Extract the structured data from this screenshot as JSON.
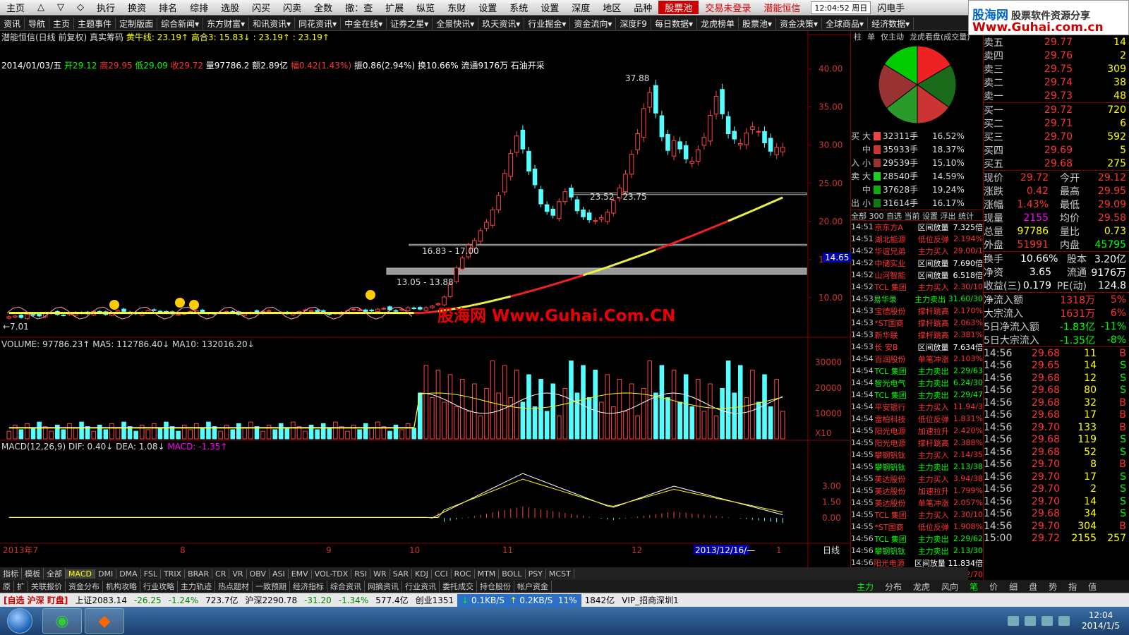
{
  "menu": {
    "items": [
      "主页",
      "△",
      "▽",
      "◇",
      "执行",
      "换资",
      "排名",
      "综排",
      "选股",
      "闪买",
      "闪卖",
      "全数",
      "撤：查",
      "扩展",
      "纵览",
      "东财",
      "设置",
      "系统",
      "设置",
      "深度",
      "地区",
      "品种"
    ],
    "highlight": "股票池",
    "login": "交易未登录",
    "stockname": "潜能恒信",
    "clock": "12:04:52 周日",
    "flash": "闪电手"
  },
  "brand": {
    "line1a": "股海网",
    "line1b": "股票软件资源分享",
    "line2": "Www.Guhai.com.cn"
  },
  "toolbar2": [
    "资讯",
    "导航",
    "主页",
    "主题事件",
    "定制版面",
    "综合新闻▾",
    "东方财富▾",
    "和讯资讯▾",
    "同花资讯▾",
    "中金在线▾",
    "证券之星▾",
    "全景快讯▾",
    "玖天资讯▾",
    "行业掘金▾",
    "资金流向▾",
    "深度F9",
    "每日数据▾",
    "龙虎榜单",
    "股票池▾",
    "资金决策▾",
    "全球商品▾",
    "经济数据▾"
  ],
  "chart": {
    "header1": "潜能恒信(日线 前复权) 真实筹码",
    "header1b": "黄牛线: 23.19↑ 高合3: 15.83↓ : 23.19↑ : 23.19↑",
    "date": "2014/01/03/五",
    "open": "开29.12",
    "high": "高29.95",
    "low": "低29.09",
    "close": "收29.72",
    "vol": "量97786.2",
    "amount": "额2.89亿",
    "chg": "幅0.42(1.43%)",
    "rest": "振0.86(2.94%) 换10.66% 流通9176万 石油开采",
    "peak_label": "37.88",
    "low_label": "←7.01",
    "zone1": "23.52 - 23.75",
    "zone2": "16.83 - 17.00",
    "zone3": "13.05 - 13.88",
    "price_marker": "14.65",
    "price_axis": [
      "40.00",
      "35.00",
      "30.00",
      "25.00",
      "20.00",
      "15.00",
      "10.00"
    ],
    "vol_header": "VOLUME: 97786.23↑  MA5: 112786.40↓  MA10: 132016.20↓",
    "vol_axis": [
      "30000",
      "20000",
      "10000",
      "X10"
    ],
    "macd_header": "MACD(12,26,9)  DIF: 0.40↓  DEA: 1.08↓",
    "macd_val": "MACD: -1.35↑",
    "macd_axis": [
      "3.00",
      "1.50",
      "0.00"
    ],
    "date_axis": [
      "2013年7",
      "8",
      "9",
      "10",
      "11",
      "12",
      "2013/12/16/—",
      "1"
    ],
    "period": "日线"
  },
  "chart_data": {
    "type": "candlestick",
    "title": "潜能恒信(日线 前复权)",
    "price_range": [
      5,
      42
    ],
    "candles": [
      [
        29.12,
        29.95,
        29.09,
        29.72
      ]
    ],
    "price_series_close_approx": [
      7.5,
      7.6,
      7.4,
      7.8,
      7.7,
      7.6,
      7.9,
      8.0,
      7.8,
      7.7,
      7.9,
      8.1,
      8.0,
      7.9,
      8.2,
      8.0,
      7.8,
      8.1,
      8.3,
      8.2,
      8.0,
      7.9,
      8.1,
      8.3,
      8.4,
      8.2,
      8.0,
      7.9,
      7.8,
      8.0,
      8.2,
      8.3,
      8.1,
      8.0,
      7.9,
      8.1,
      8.2,
      8.0,
      7.8,
      7.9,
      8.1,
      8.0,
      8.2,
      8.3,
      8.1,
      8.0,
      7.9,
      8.0,
      8.2,
      8.4,
      8.3,
      8.1,
      8.0,
      7.8,
      8.0,
      8.1,
      8.3,
      8.5,
      8.4,
      8.2,
      8.3,
      8.5,
      8.6,
      8.4,
      8.3,
      8.5,
      8.7,
      8.6,
      8.5,
      8.7,
      8.9,
      9.2,
      10.1,
      11.8,
      13.9,
      15.2,
      16.9,
      17.5,
      18.8,
      19.9,
      21.5,
      23.4,
      26.3,
      28.9,
      31.2,
      29.5,
      26.6,
      24.8,
      22.3,
      21.3,
      20.8,
      22.6,
      23.9,
      23.2,
      21.4,
      20.6,
      20.2,
      20.1,
      20.5,
      21.2,
      22.7,
      24.4,
      26.2,
      28.8,
      31.5,
      34.8,
      36.9,
      34.2,
      31.1,
      29.3,
      30.6,
      29.5,
      28.2,
      27.9,
      29.4,
      31.0,
      33.9,
      36.4,
      34.1,
      31.5,
      30.8,
      30.2,
      31.6,
      32.4,
      31.8,
      30.3,
      29.2,
      29.7,
      29.72
    ],
    "volume_range": [
      0,
      36000
    ],
    "volume_ma5_last": 112786.4,
    "volume_ma10_last": 132016.2,
    "volume_last": 97786.23,
    "macd": {
      "dif": 0.4,
      "dea": 1.08,
      "macd": -1.35
    },
    "zones": [
      "23.52 - 23.75",
      "16.83 - 17.00",
      "13.05 - 13.88"
    ]
  },
  "fund": {
    "tabs": [
      "柱",
      "单",
      "仅主动",
      "龙虎看盘(成交量)"
    ],
    "pie_colors": [
      "#e22",
      "#1a6b1a",
      "#c33",
      "#2a9a2a",
      "#933",
      "#0c0"
    ],
    "buy_label": [
      "买",
      "入"
    ],
    "sell_label": [
      "卖",
      "出"
    ],
    "rows": [
      {
        "k": "大",
        "v": "32311手",
        "p": "16.52%",
        "c": "#e44"
      },
      {
        "k": "中",
        "v": "35933手",
        "p": "18.37%",
        "c": "#c33"
      },
      {
        "k": "小",
        "v": "29539手",
        "p": "15.10%",
        "c": "#933"
      },
      {
        "k": "大",
        "v": "28540手",
        "p": "14.59%",
        "c": "#2c2"
      },
      {
        "k": "中",
        "v": "37628手",
        "p": "19.24%",
        "c": "#1a1"
      },
      {
        "k": "小",
        "v": "31614手",
        "p": "16.17%",
        "c": "#171"
      }
    ],
    "filter": "全部 300 自选 当前 设置 浮出 统计"
  },
  "flow": [
    [
      "14:51",
      "京东方A",
      "区间放量",
      "7.325倍",
      "wht"
    ],
    [
      "14:51",
      "湖北能源",
      "低位反弹",
      "2.194%",
      "red"
    ],
    [
      "14:52",
      "华谊兄弟",
      "主力买入",
      "29.00/1",
      "red"
    ],
    [
      "14:52",
      "中储实业",
      "区间放量",
      "7.690倍",
      "wht"
    ],
    [
      "14:52",
      "山河智能",
      "区间放量",
      "6.518倍",
      "wht"
    ],
    [
      "14:52",
      "TCL 集团",
      "主力买入",
      "2.30/10",
      "red"
    ],
    [
      "14:53",
      "易华录",
      "主力卖出",
      "31.60/30",
      "grn"
    ],
    [
      "14:53",
      "宝德股份",
      "撑杆跳高",
      "2.170%",
      "red"
    ],
    [
      "14:53",
      "*ST国商",
      "撑杆跳高",
      "2.063%",
      "red"
    ],
    [
      "14:53",
      "新华联",
      "撑杆跳高",
      "2.381%",
      "red"
    ],
    [
      "14:53",
      "长 安B",
      "区间放量",
      "7.634倍",
      "wht"
    ],
    [
      "14:54",
      "百润股份",
      "单笔冲涨",
      "2.103%",
      "red"
    ],
    [
      "14:54",
      "TCL 集团",
      "主力卖出",
      "2.29/63",
      "grn"
    ],
    [
      "14:54",
      "智光电气",
      "主力卖出",
      "6.24/30",
      "grn"
    ],
    [
      "14:54",
      "TCL 集团",
      "主力卖出",
      "2.29/47",
      "grn"
    ],
    [
      "14:54",
      "平安银行",
      "主力买入",
      "11.94/3",
      "red"
    ],
    [
      "14:54",
      "雷柏科技",
      "低位反弹",
      "1.831%",
      "red"
    ],
    [
      "14:55",
      "阳光电源",
      "加速拉升",
      "2.420%",
      "red"
    ],
    [
      "14:55",
      "阳光电源",
      "撑杆跳高",
      "2.388%",
      "red"
    ],
    [
      "14:55",
      "攀钢钒钛",
      "主力买入",
      "2.14/35",
      "red"
    ],
    [
      "14:55",
      "攀钢钒钛",
      "主力卖出",
      "2.13/38",
      "grn"
    ],
    [
      "14:55",
      "美达股份",
      "主力买入",
      "3.94/38",
      "red"
    ],
    [
      "14:55",
      "美达股份",
      "加速拉升",
      "1.799%",
      "red"
    ],
    [
      "14:55",
      "美达股份",
      "单笔冲涨",
      "2.057%",
      "red"
    ],
    [
      "14:55",
      "TCL 集团",
      "主力买入",
      "2.30/10",
      "red"
    ],
    [
      "14:55",
      "*ST国商",
      "低位反弹",
      "1.908%",
      "red"
    ],
    [
      "14:56",
      "TCL 集团",
      "主力卖出",
      "2.29/62",
      "grn"
    ],
    [
      "14:56",
      "攀钢钒钛",
      "主力卖出",
      "2.13/30",
      "grn"
    ],
    [
      "14:56",
      "阳光电源",
      "区间放量",
      "11.834倍",
      "wht"
    ],
    [
      "14:56",
      "三湘股份",
      "主力买入",
      "6.52/70",
      "red"
    ],
    [
      "14:56",
      "中钢吉炭",
      "加速拉升",
      "1.816%",
      "red"
    ],
    [
      "14:56",
      "凯迪电力",
      "主力卖出",
      "6.38/41",
      "grn"
    ],
    [
      "14:56",
      "山东路桥",
      "低位反弹",
      "1.869%",
      "red"
    ],
    [
      "14:56",
      "山东路桥",
      "撑杆跳高",
      "2.570%",
      "red"
    ]
  ],
  "quote": {
    "code": "300191 潜能恒信",
    "asks": [
      [
        "卖五",
        "29.77",
        "14"
      ],
      [
        "卖四",
        "29.76",
        "2"
      ],
      [
        "卖三",
        "29.75",
        "309"
      ],
      [
        "卖二",
        "29.74",
        "38"
      ],
      [
        "卖一",
        "29.73",
        "48"
      ]
    ],
    "bids": [
      [
        "买一",
        "29.72",
        "720"
      ],
      [
        "买二",
        "29.71",
        "6"
      ],
      [
        "买三",
        "29.70",
        "592"
      ],
      [
        "买四",
        "29.69",
        "5"
      ],
      [
        "买五",
        "29.68",
        "275"
      ]
    ],
    "stats": [
      [
        "现价",
        "29.72",
        "red",
        "今开",
        "29.12",
        "red"
      ],
      [
        "涨跌",
        "0.42",
        "red",
        "最高",
        "29.95",
        "red"
      ],
      [
        "涨幅",
        "1.43%",
        "red",
        "最低",
        "29.09",
        "red"
      ],
      [
        "现量",
        "2155",
        "mag",
        "均价",
        "29.58",
        "red"
      ],
      [
        "总量",
        "97786",
        "yel",
        "量比",
        "0.73",
        "yel"
      ],
      [
        "外盘",
        "51991",
        "red",
        "内盘",
        "45795",
        "grn"
      ]
    ],
    "stats2": [
      [
        "换手",
        "10.66%",
        "股本",
        "3.20亿"
      ],
      [
        "净资",
        "3.65",
        "流通",
        "9176万"
      ],
      [
        "收益(三)",
        "0.179",
        "PE(动)",
        "124.8"
      ]
    ],
    "netflow": [
      [
        "净流入额",
        "1318万",
        "5%",
        "red"
      ],
      [
        "大宗流入",
        "1631万",
        "6%",
        "red"
      ],
      [
        "5日净流入额",
        "-1.83亿",
        "-11%",
        "grn"
      ],
      [
        "5日大宗流入",
        "-1.35亿",
        "-8%",
        "grn"
      ]
    ],
    "ticks": [
      [
        "14:56",
        "29.68",
        "11",
        "B"
      ],
      [
        "14:56",
        "29.65",
        "14",
        "S"
      ],
      [
        "14:56",
        "29.68",
        "12",
        "S"
      ],
      [
        "14:56",
        "29.68",
        "80",
        "S"
      ],
      [
        "14:56",
        "29.68",
        "32",
        "B"
      ],
      [
        "14:56",
        "29.68",
        "17",
        "B"
      ],
      [
        "14:56",
        "29.70",
        "133",
        "B"
      ],
      [
        "14:56",
        "29.68",
        "119",
        "S"
      ],
      [
        "14:56",
        "29.68",
        "52",
        "S"
      ],
      [
        "14:56",
        "29.70",
        "8",
        "B"
      ],
      [
        "14:56",
        "29.70",
        "17",
        "S"
      ],
      [
        "14:56",
        "29.70",
        "2",
        "S"
      ],
      [
        "14:56",
        "29.70",
        "14",
        "S"
      ],
      [
        "14:56",
        "29.68",
        "34",
        "S"
      ],
      [
        "14:56",
        "29.70",
        "304",
        "B"
      ],
      [
        "15:00",
        "29.72",
        "2155",
        "257"
      ]
    ]
  },
  "bottomtabs": [
    "指标",
    "模板",
    "全部",
    "MACD",
    "DMI",
    "DMA",
    "FSL",
    "TRIX",
    "BRAR",
    "CR",
    "VR",
    "OBV",
    "ASI",
    "EMV",
    "VOL-TDX",
    "RSI",
    "WR",
    "SAR",
    "KDJ",
    "CCI",
    "ROC",
    "MTM",
    "BOLL",
    "PSY",
    "MCST"
  ],
  "bottomtabs2": [
    "原",
    "扩",
    "关联报价",
    "资金分布",
    "机构攻略",
    "行业攻略",
    "主力轨迹",
    "热点题材",
    "一致预期",
    "经济指标",
    "综合资讯",
    "网摘资讯",
    "行业资讯",
    "委托成交",
    "持仓股份",
    "帐户资金"
  ],
  "rtabs": [
    "主力",
    "分布",
    "龙虎",
    "风向",
    "笔",
    "价",
    "细",
    "盘",
    "势",
    "指",
    "值"
  ],
  "status": {
    "left": "[自选 沪深 盯盘]",
    "sh": "上证2083.14",
    "sh_chg": "-26.25",
    "sh_pct": "-1.24%",
    "sh_amt": "723.7亿",
    "hs": "沪深2290.78",
    "hs_chg": "-31.20",
    "hs_pct": "-1.34%",
    "hs_amt": "577.4亿",
    "cy": "创业1351",
    "down": "0.1KB/S",
    "up": "0.2KB/S",
    "pct": "11%",
    "amt": "1842亿",
    "vip": "VIP_招商深圳1"
  },
  "taskbar": {
    "time": "12:04",
    "date": "2014/1/5"
  },
  "watermark": "股海网 Www.Guhai.Com.CN"
}
